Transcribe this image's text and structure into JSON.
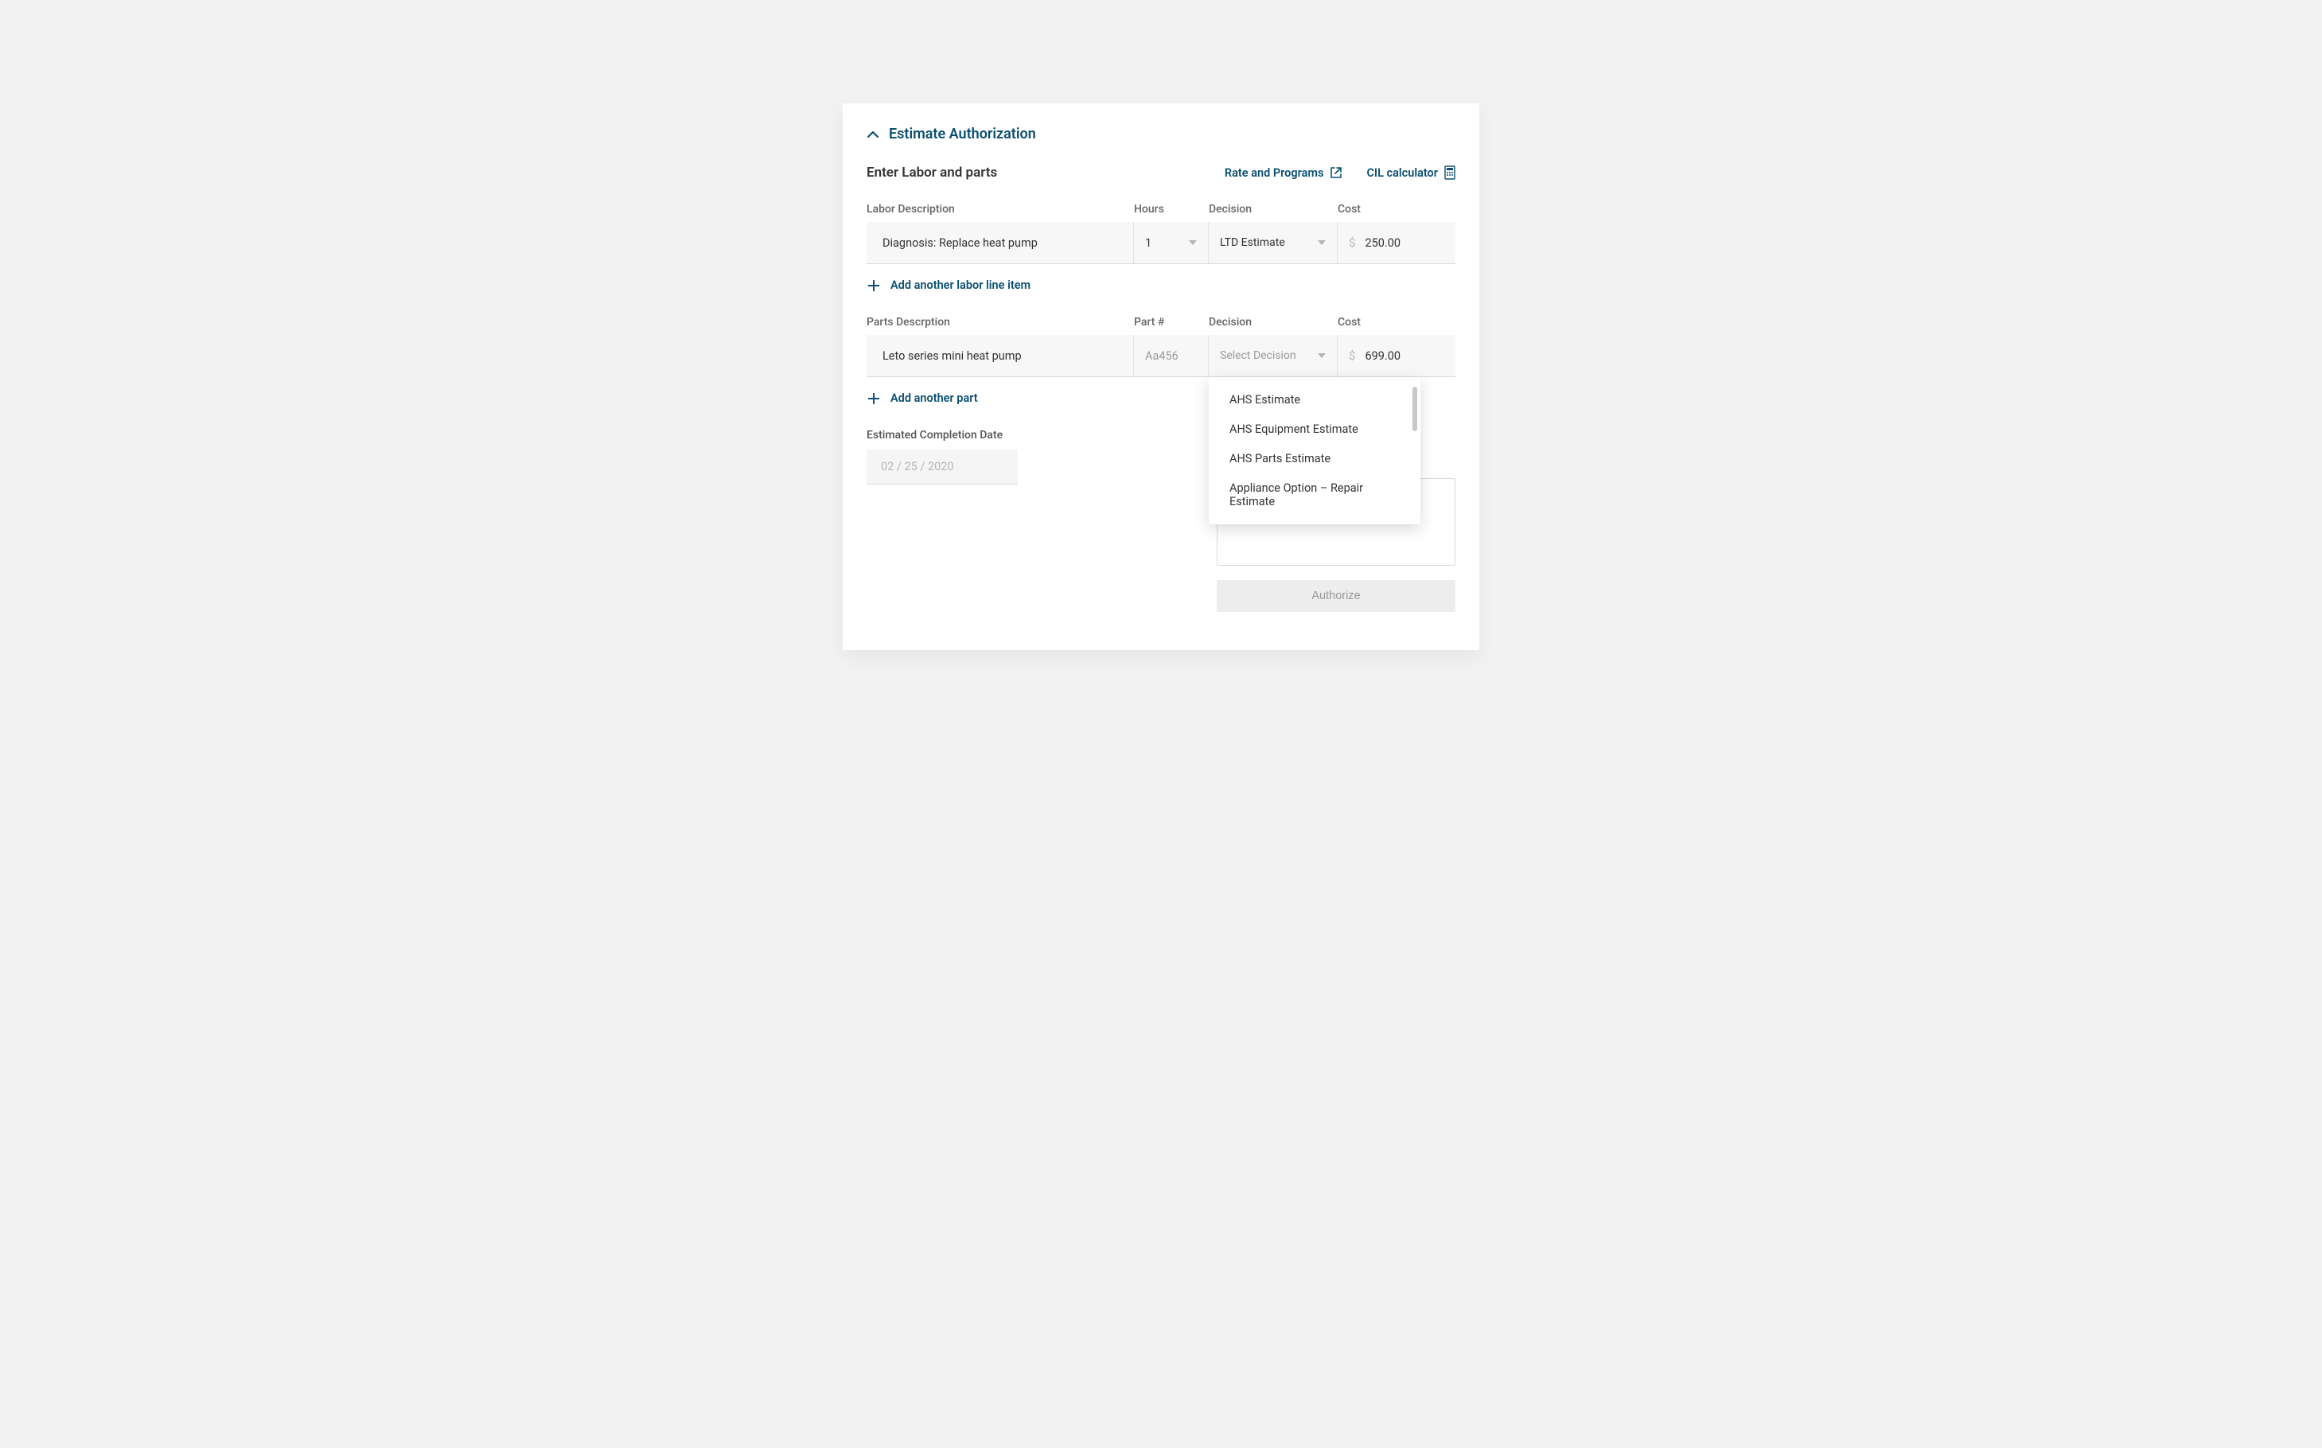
{
  "section": {
    "title": "Estimate Authorization"
  },
  "subheader": {
    "title": "Enter Labor and parts",
    "rate_link": "Rate and Programs",
    "cil_link": "CIL calculator"
  },
  "labor": {
    "cols": {
      "desc": "Labor Description",
      "hours": "Hours",
      "decision": "Decision",
      "cost": "Cost"
    },
    "rows": [
      {
        "desc": "Diagnosis: Replace heat pump",
        "hours": "1",
        "decision": "LTD Estimate",
        "cost": "250.00"
      }
    ],
    "add_label": "Add another labor line item"
  },
  "parts": {
    "cols": {
      "desc": "Parts Descrption",
      "partnum": "Part #",
      "decision": "Decision",
      "cost": "Cost"
    },
    "rows": [
      {
        "desc": "Leto series mini heat pump",
        "partnum": "Aa456",
        "decision_placeholder": "Select Decision",
        "cost": "699.00"
      }
    ],
    "add_label": "Add another part",
    "decision_options": [
      "AHS Estimate",
      "AHS Equipment Estimate",
      "AHS Parts Estimate",
      "Appliance Option – Repair Estimate"
    ]
  },
  "completion": {
    "label": "Estimated Completion Date",
    "value": "02 / 25  / 2020"
  },
  "authorize": {
    "label": "Authorize"
  }
}
